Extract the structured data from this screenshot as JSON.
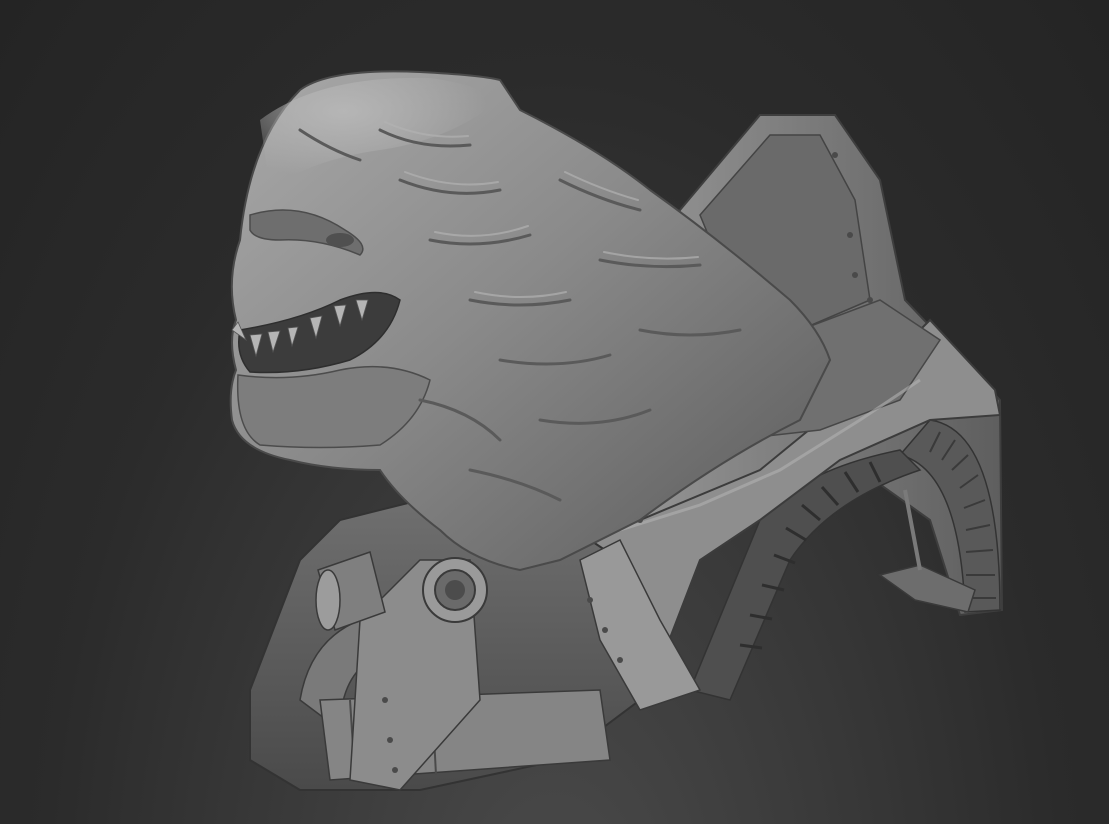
{
  "viewport": {
    "subject": "",
    "background_color": "#2b2b2b",
    "material_color": "#8a8a8a"
  }
}
